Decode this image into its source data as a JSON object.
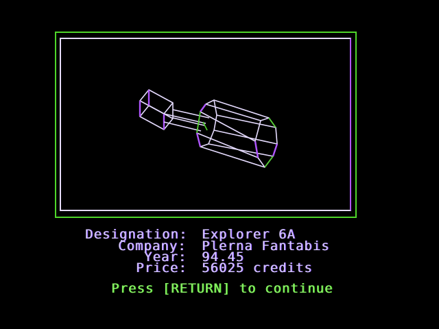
{
  "ship_info": {
    "designation_label": "Designation:",
    "designation_value": "Explorer 6A",
    "company_label": "Company:",
    "company_value": "Plerna Fantabis",
    "year_label": "Year:",
    "year_value": "94.45",
    "price_label": "Price:",
    "price_value": "56025 credits"
  },
  "prompt": "Press [RETURN] to continue",
  "colors": {
    "outer_frame": "#4fd62a",
    "inner_frame": "#e6dcff",
    "wireframe_white": "#e6dcff",
    "wireframe_violet": "#b056ff",
    "wireframe_green": "#4fd62a",
    "text": "#d6c8ff",
    "prompt_text": "#8df06a"
  }
}
